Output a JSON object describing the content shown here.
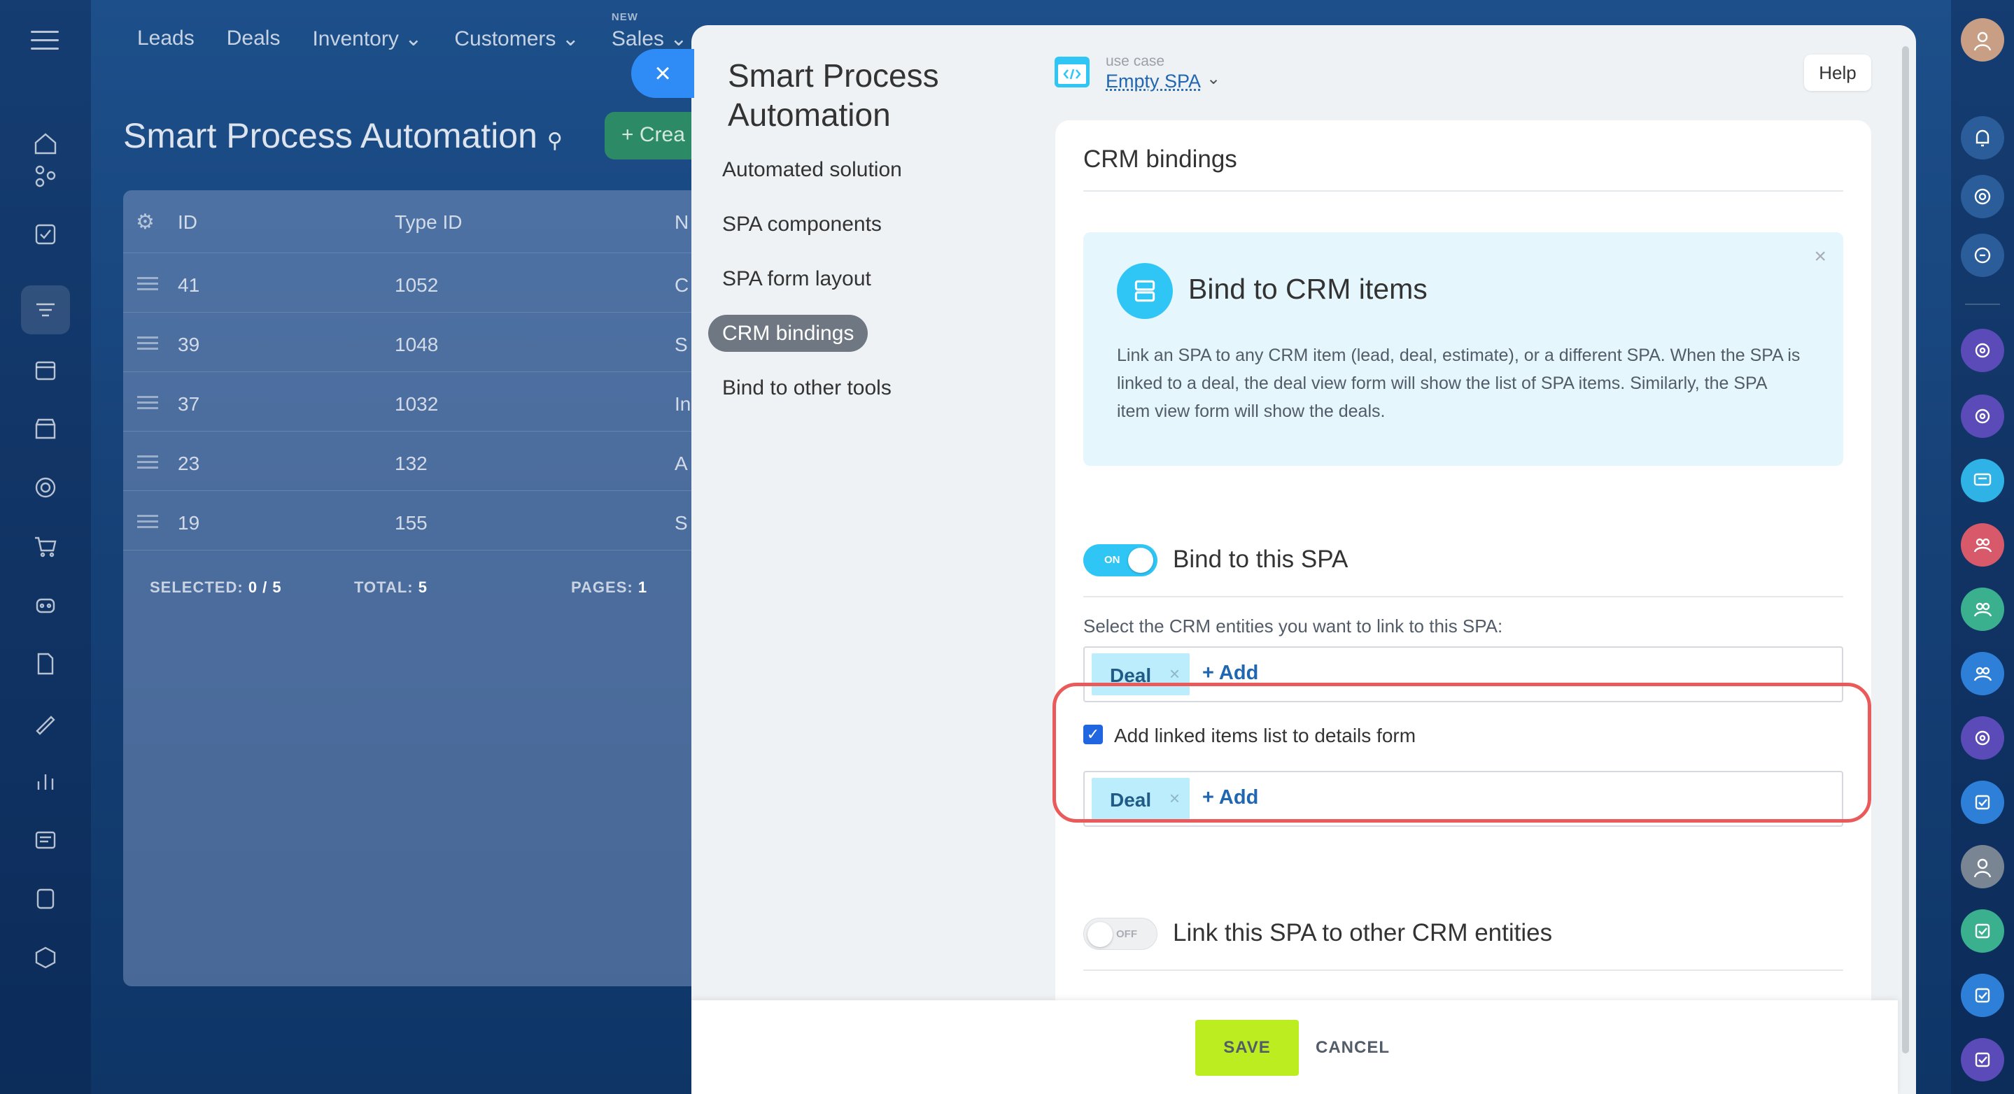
{
  "background": {
    "nav": [
      {
        "label": "Leads"
      },
      {
        "label": "Deals"
      },
      {
        "label": "Inventory",
        "chevron": true
      },
      {
        "label": "Customers",
        "chevron": true
      },
      {
        "label": "Sales",
        "chevron": true,
        "badge": "NEW"
      }
    ],
    "page_title": "Smart Process Automation",
    "create_label": "+ Crea",
    "grid": {
      "headers": {
        "id": "ID",
        "type_id": "Type ID",
        "name": "N"
      },
      "rows": [
        {
          "id": "41",
          "type_id": "1052",
          "name": "C"
        },
        {
          "id": "39",
          "type_id": "1048",
          "name": "S"
        },
        {
          "id": "37",
          "type_id": "1032",
          "name": "In"
        },
        {
          "id": "23",
          "type_id": "132",
          "name": "A"
        },
        {
          "id": "19",
          "type_id": "155",
          "name": "S"
        }
      ],
      "footer": {
        "selected_label": "SELECTED:",
        "selected_value": "0 / 5",
        "total_label": "TOTAL:",
        "total_value": "5",
        "pages_label": "PAGES:",
        "pages_value": "1"
      }
    }
  },
  "panel": {
    "close_symbol": "×",
    "title_line1": "Smart Process",
    "title_line2": "Automation",
    "nav": [
      {
        "label": "Automated solution"
      },
      {
        "label": "SPA components"
      },
      {
        "label": "SPA form layout"
      },
      {
        "label": "CRM bindings",
        "active": true
      },
      {
        "label": "Bind to other tools"
      }
    ],
    "use_case_label": "use case",
    "use_case_value": "Empty SPA",
    "help_label": "Help",
    "section_title": "CRM bindings",
    "info": {
      "title": "Bind to CRM items",
      "text": "Link an SPA to any CRM item (lead, deal, estimate), or a different SPA. When the SPA is linked to a deal, the deal view form will show the list of SPA items. Similarly, the SPA item view form will show the deals."
    },
    "bind_toggle": {
      "state_label": "ON",
      "label": "Bind to this SPA",
      "on": true
    },
    "entities_hint": "Select the CRM entities you want to link to this SPA:",
    "entities_field": {
      "tag": "Deal",
      "add_label": "+ Add"
    },
    "linked_checkbox": {
      "label": "Add linked items list to details form",
      "checked": true
    },
    "linked_field": {
      "tag": "Deal",
      "add_label": "+ Add"
    },
    "link_toggle": {
      "state_label": "OFF",
      "label": "Link this SPA to other CRM entities",
      "on": false
    },
    "save_label": "SAVE",
    "cancel_label": "CANCEL"
  },
  "colors": {
    "accent": "#2fc6f6",
    "link": "#2066b0",
    "save": "#bbed21",
    "highlight": "#ea5a5a",
    "tag": "#bcedfc"
  }
}
